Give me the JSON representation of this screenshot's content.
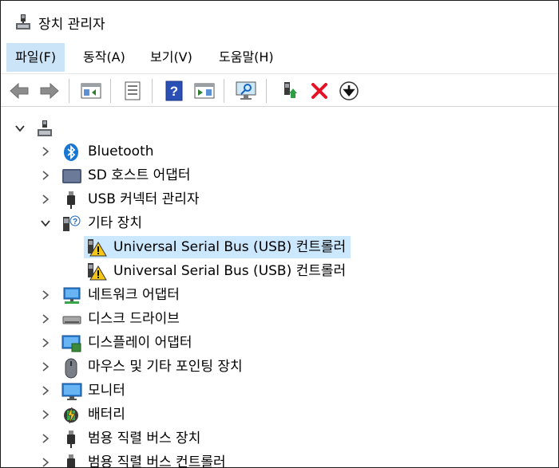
{
  "window": {
    "title": "장치 관리자"
  },
  "menu": [
    {
      "label": "파일(F)"
    },
    {
      "label": "동작(A)"
    },
    {
      "label": "보기(V)"
    },
    {
      "label": "도움말(H)"
    }
  ],
  "toolbar": {
    "buttons": [
      "back-icon",
      "forward-icon",
      "properties-pane-icon",
      "properties-icon",
      "help-icon",
      "show-hide-pane-icon",
      "scan-hardware-icon",
      "update-driver-icon",
      "uninstall-icon",
      "download-icon"
    ]
  },
  "tree": {
    "root": {
      "label": ""
    },
    "items": [
      {
        "label": "Bluetooth"
      },
      {
        "label": "SD 호스트 어댑터"
      },
      {
        "label": "USB 커넥터 관리자"
      },
      {
        "label": "기타 장치",
        "children": [
          {
            "label": "Universal Serial Bus (USB) 컨트롤러"
          },
          {
            "label": "Universal Serial Bus (USB) 컨트롤러"
          }
        ]
      },
      {
        "label": "네트워크 어댑터"
      },
      {
        "label": "디스크 드라이브"
      },
      {
        "label": "디스플레이 어댑터"
      },
      {
        "label": "마우스 및 기타 포인팅 장치"
      },
      {
        "label": "모니터"
      },
      {
        "label": "배터리"
      },
      {
        "label": "범용 직렬 버스 장치"
      },
      {
        "label": "범용 직렬 버스 컨트롤러"
      }
    ]
  },
  "colors": {
    "selection": "#cce8ff",
    "menu_active": "#cce4f7",
    "warning": "#f5c518",
    "bluetooth": "#1976d2",
    "uninstall": "#e81123"
  }
}
